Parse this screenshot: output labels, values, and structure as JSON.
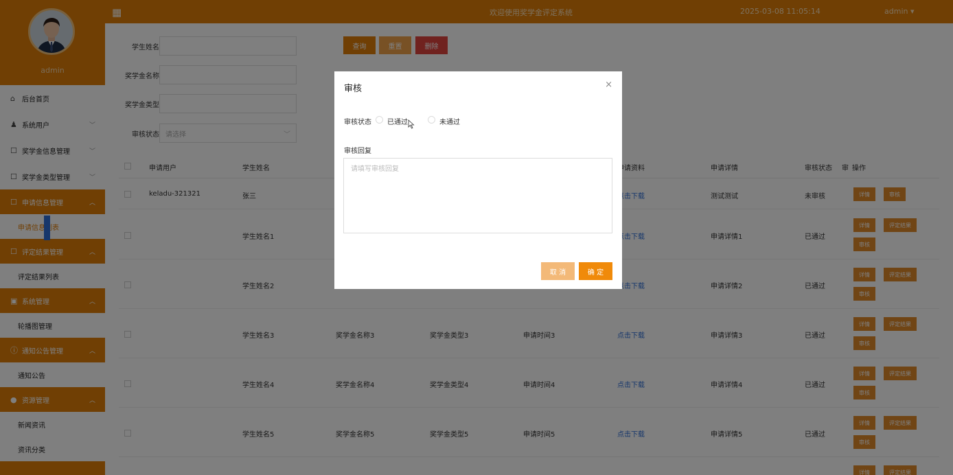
{
  "header": {
    "title": "欢迎使用奖学金评定系统",
    "time": "2025-03-08 11:05:14",
    "user": "admin ▾"
  },
  "sidebar": {
    "username": "admin",
    "items": [
      {
        "label": "后台首页",
        "icon": "home-icon",
        "glyph": "⌂"
      },
      {
        "label": "系统用户",
        "icon": "user-icon",
        "glyph": "●"
      },
      {
        "label": "奖学金信息管理",
        "icon": "doc-icon",
        "glyph": "☐"
      },
      {
        "label": "奖学金类型管理",
        "icon": "doc-icon",
        "glyph": "☐"
      }
    ],
    "groups": [
      {
        "label": "申请信息管理",
        "icon": "doc-icon",
        "sub": [
          "申请信息列表"
        ]
      },
      {
        "label": "评定结果管理",
        "icon": "doc-icon",
        "sub": [
          "评定结果列表"
        ]
      },
      {
        "label": "系统管理",
        "icon": "image-icon",
        "sub": [
          "轮播图管理"
        ]
      },
      {
        "label": "通知公告管理",
        "icon": "alert-icon",
        "sub": [
          "通知公告"
        ]
      },
      {
        "label": "资源管理",
        "icon": "bulb-icon",
        "sub": [
          "新闻资讯",
          "资讯分类"
        ]
      }
    ]
  },
  "search": {
    "student_name_label": "学生姓名",
    "scholarship_name_label": "奖学金名称",
    "scholarship_type_label": "奖学金类型",
    "status_label": "审核状态",
    "status_placeholder": "请选择",
    "query": "查询",
    "reset": "重置",
    "delete": "删除"
  },
  "table": {
    "headers": [
      "申请用户",
      "学生姓名",
      "申请资料",
      "申请详情",
      "审核状态",
      "审",
      "操作"
    ],
    "rows": [
      {
        "user": "keladu-321321",
        "name": "张三",
        "scholarship": "",
        "type": "",
        "time": "",
        "file": "点击下载",
        "detail": "测试测试",
        "status": "未审核"
      },
      {
        "user": "",
        "name": "学生姓名1",
        "scholarship": "",
        "type": "",
        "time": "",
        "file": "点击下载",
        "detail": "申请详情1",
        "status": "已通过"
      },
      {
        "user": "",
        "name": "学生姓名2",
        "scholarship": "",
        "type": "",
        "time": "",
        "file": "点击下载",
        "detail": "申请详情2",
        "status": "已通过"
      },
      {
        "user": "",
        "name": "学生姓名3",
        "scholarship": "奖学金名称3",
        "type": "奖学金类型3",
        "time": "申请时间3",
        "file": "点击下载",
        "detail": "申请详情3",
        "status": "已通过"
      },
      {
        "user": "",
        "name": "学生姓名4",
        "scholarship": "奖学金名称4",
        "type": "奖学金类型4",
        "time": "申请时间4",
        "file": "点击下载",
        "detail": "申请详情4",
        "status": "已通过"
      },
      {
        "user": "",
        "name": "学生姓名5",
        "scholarship": "奖学金名称5",
        "type": "奖学金类型5",
        "time": "申请时间5",
        "file": "点击下载",
        "detail": "申请详情5",
        "status": "已通过"
      }
    ],
    "op_detail": "详情",
    "op_audit": "审核",
    "op_result": "评定结果"
  },
  "dialog": {
    "title": "审核",
    "close": "×",
    "status_label": "审核状态",
    "option_pass": "已通过",
    "option_fail": "未通过",
    "reply_label": "审核回复",
    "reply_placeholder": "请填写审核回复",
    "cancel": "取 消",
    "ok": "确 定"
  }
}
